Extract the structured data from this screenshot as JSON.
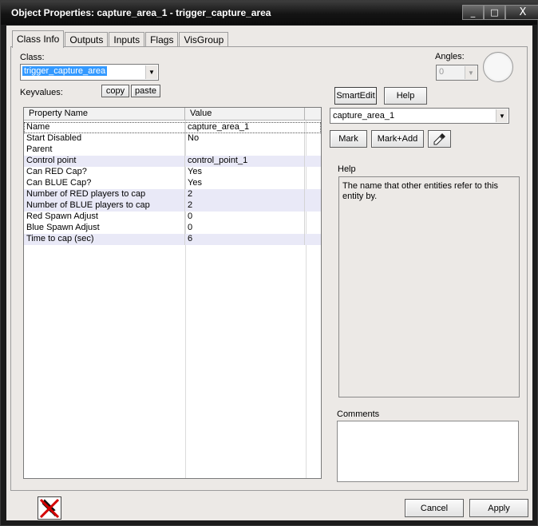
{
  "window": {
    "title": "Object Properties: capture_area_1 - trigger_capture_area",
    "min_glyph": "_",
    "max_glyph": "□",
    "close_glyph": "X"
  },
  "tabs": [
    {
      "label": "Class Info"
    },
    {
      "label": "Outputs"
    },
    {
      "label": "Inputs"
    },
    {
      "label": "Flags"
    },
    {
      "label": "VisGroup"
    }
  ],
  "class_info": {
    "class_label": "Class:",
    "class_value": "trigger_capture_area",
    "keyvalues_label": "Keyvalues:",
    "copy_label": "copy",
    "paste_label": "paste",
    "smartedit_label": "SmartEdit",
    "help_label": "Help",
    "angles_label": "Angles:",
    "angles_value": "0"
  },
  "grid": {
    "col_property": "Property Name",
    "col_value": "Value",
    "rows": [
      {
        "key": "Name",
        "value": "capture_area_1"
      },
      {
        "key": "Start Disabled",
        "value": "No"
      },
      {
        "key": "Parent",
        "value": ""
      },
      {
        "key": "Control point",
        "value": "control_point_1"
      },
      {
        "key": "Can RED Cap?",
        "value": "Yes"
      },
      {
        "key": "Can BLUE Cap?",
        "value": "Yes"
      },
      {
        "key": "Number of RED players to cap",
        "value": "2"
      },
      {
        "key": "Number of BLUE players to cap",
        "value": "2"
      },
      {
        "key": "Red Spawn Adjust",
        "value": "0"
      },
      {
        "key": "Blue Spawn Adjust",
        "value": "0"
      },
      {
        "key": "Time to cap (sec)",
        "value": "6"
      }
    ]
  },
  "right_panel": {
    "value_combo": "capture_area_1",
    "mark_label": "Mark",
    "mark_add_label": "Mark+Add",
    "help_heading": "Help",
    "help_text": "The name that other entities refer to this entity by.",
    "comments_heading": "Comments",
    "comments_text": ""
  },
  "footer": {
    "cancel_label": "Cancel",
    "apply_label": "Apply"
  },
  "colors": {
    "selection": "#3399ff",
    "alt_row": "#e9e9f7",
    "icon_red": "#d40000"
  }
}
